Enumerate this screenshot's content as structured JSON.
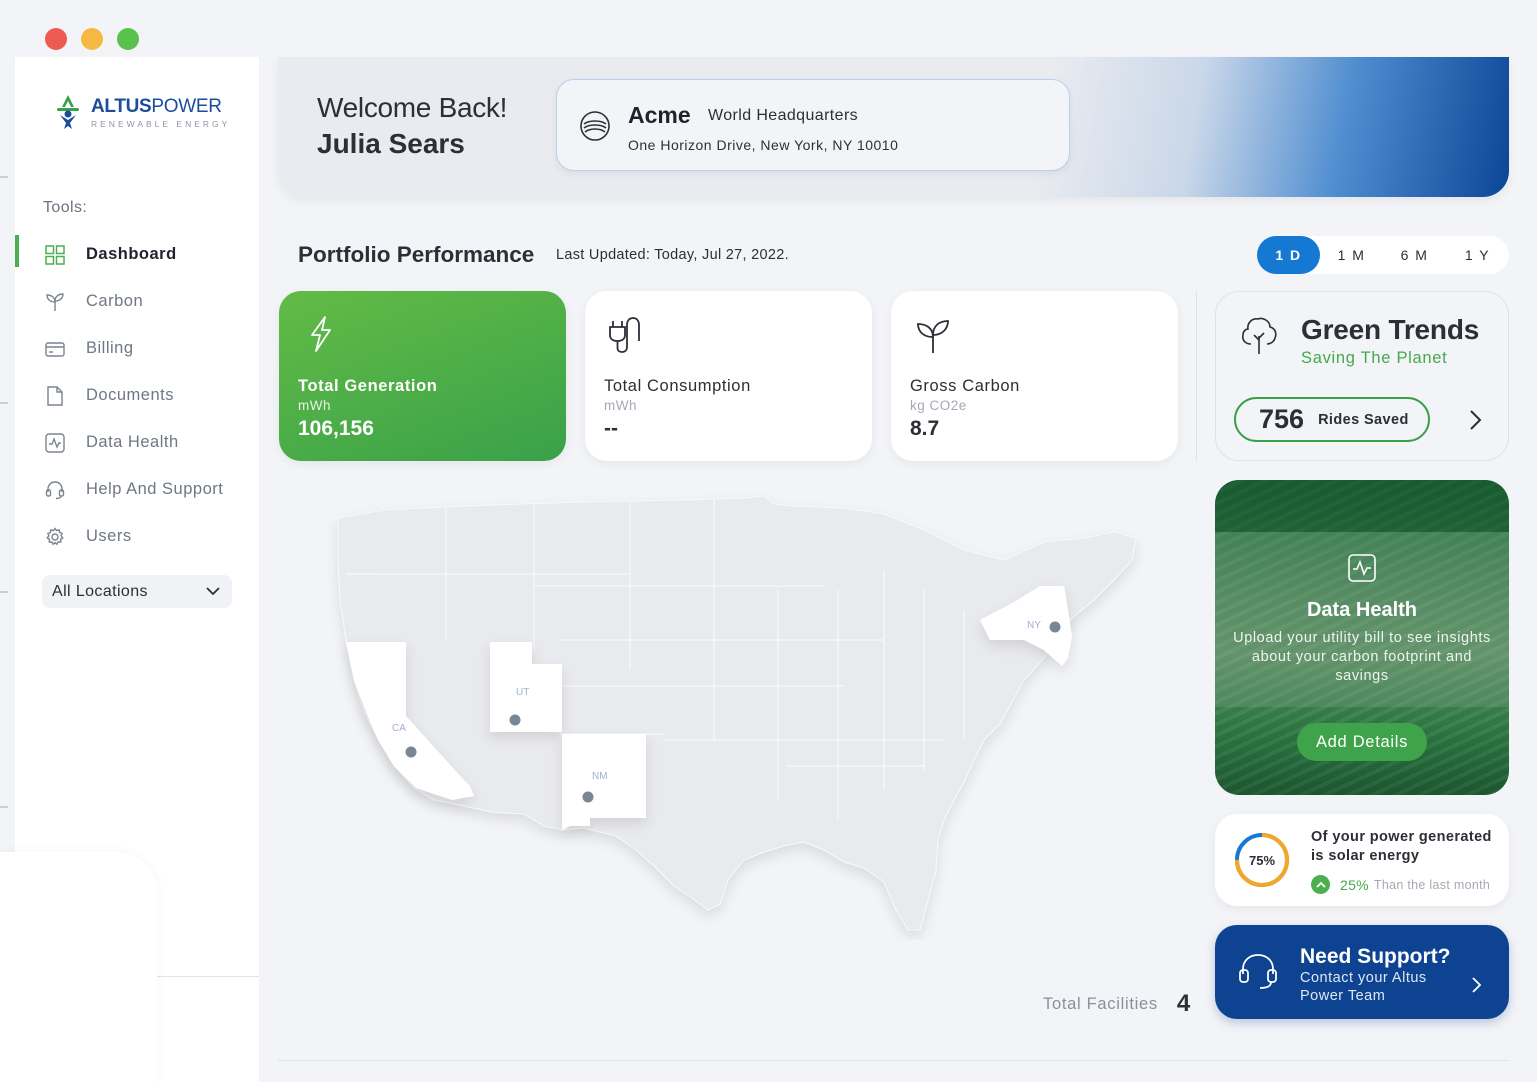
{
  "window": {
    "controls": [
      "close",
      "minimize",
      "maximize"
    ]
  },
  "brand": {
    "name_bold": "ALTUS",
    "name_light": "POWER",
    "tagline": "RENEWABLE ENERGY",
    "logo_icon": "altus-logo-icon"
  },
  "sidebar": {
    "tools_label": "Tools:",
    "items": [
      {
        "label": "Dashboard",
        "icon": "grid-icon",
        "active": true
      },
      {
        "label": "Carbon",
        "icon": "sprout-icon"
      },
      {
        "label": "Billing",
        "icon": "card-icon"
      },
      {
        "label": "Documents",
        "icon": "document-icon"
      },
      {
        "label": "Data Health",
        "icon": "pulse-icon"
      },
      {
        "label": "Help And Support",
        "icon": "headset-icon"
      },
      {
        "label": "Users",
        "icon": "gear-icon"
      }
    ],
    "location_select": {
      "value": "All Locations"
    }
  },
  "header": {
    "welcome": "Welcome Back!",
    "user_name": "Julia Sears",
    "site": {
      "company": "Acme",
      "label": "World Headquarters",
      "address": "One Horizon Drive, New York, NY 10010"
    }
  },
  "portfolio": {
    "title": "Portfolio Performance",
    "last_updated": "Last Updated: Today, Jul 27, 2022.",
    "periods": [
      "1 D",
      "1 M",
      "6 M",
      "1 Y"
    ],
    "active_period": "1 D",
    "stats": [
      {
        "title": "Total Generation",
        "unit": "mWh",
        "value": "106,156",
        "icon": "lightning-icon"
      },
      {
        "title": "Total Consumption",
        "unit": "mWh",
        "value": "--",
        "icon": "plug-icon"
      },
      {
        "title": "Gross Carbon",
        "unit": "kg CO2e",
        "value": "8.7",
        "icon": "sprout-icon"
      }
    ]
  },
  "green_trends": {
    "title": "Green Trends",
    "subtitle": "Saving The Planet",
    "rides_value": "756",
    "rides_label": "Rides Saved"
  },
  "map": {
    "states": [
      "CA",
      "UT",
      "NM",
      "NY"
    ]
  },
  "data_health": {
    "title": "Data Health",
    "text": "Upload your utility bill to see insights about your carbon footprint and savings",
    "button": "Add Details"
  },
  "solar": {
    "percent": 75,
    "percent_label": "75%",
    "title": "Of your power generated is solar energy",
    "change": "25%",
    "change_rest": "Than the last month",
    "colors": {
      "ring_solar": "#f5a623",
      "ring_rest": "#1578d3",
      "up": "#4caf50"
    }
  },
  "support": {
    "title": "Need Support?",
    "subtitle": "Contact your Altus Power Team"
  },
  "facilities": {
    "label": "Total Facilities",
    "value": "4"
  },
  "colors": {
    "accent_green": "#3aa14a",
    "accent_blue": "#1578d3",
    "navy": "#0e4391"
  }
}
